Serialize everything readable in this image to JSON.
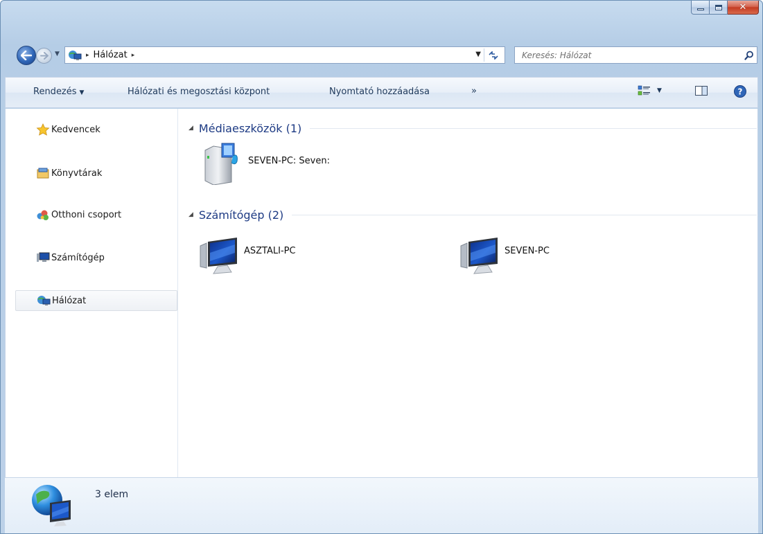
{
  "window": {
    "caption": {
      "minimize": "–",
      "maximize": "□",
      "close": "✕"
    }
  },
  "address": {
    "location": "Hálózat",
    "separator": "▸",
    "icon": "network-icon"
  },
  "search": {
    "placeholder": "Keresés: Hálózat"
  },
  "commandbar": {
    "organize": "Rendezés",
    "network_center": "Hálózati és megosztási központ",
    "add_printer": "Nyomtató hozzáadása",
    "more": "»"
  },
  "nav": [
    {
      "label": "Kedvencek",
      "icon": "star-icon"
    },
    {
      "label": "Könyvtárak",
      "icon": "library-icon"
    },
    {
      "label": "Otthoni csoport",
      "icon": "homegroup-icon"
    },
    {
      "label": "Számítógép",
      "icon": "computer-icon"
    },
    {
      "label": "Hálózat",
      "icon": "network-icon",
      "selected": true
    }
  ],
  "groups": [
    {
      "title": "Médiaeszközök (1)",
      "items": [
        {
          "label": "SEVEN-PC: Seven:",
          "icon": "media-device-icon"
        }
      ]
    },
    {
      "title": "Számítógép (2)",
      "items": [
        {
          "label": "ASZTALI-PC",
          "icon": "computer-icon"
        },
        {
          "label": "SEVEN-PC",
          "icon": "computer-icon"
        }
      ]
    }
  ],
  "details": {
    "count": "3 elem"
  },
  "colors": {
    "accent": "#1e3b84",
    "frame": "#bcd1e8",
    "close": "#c43c23"
  }
}
